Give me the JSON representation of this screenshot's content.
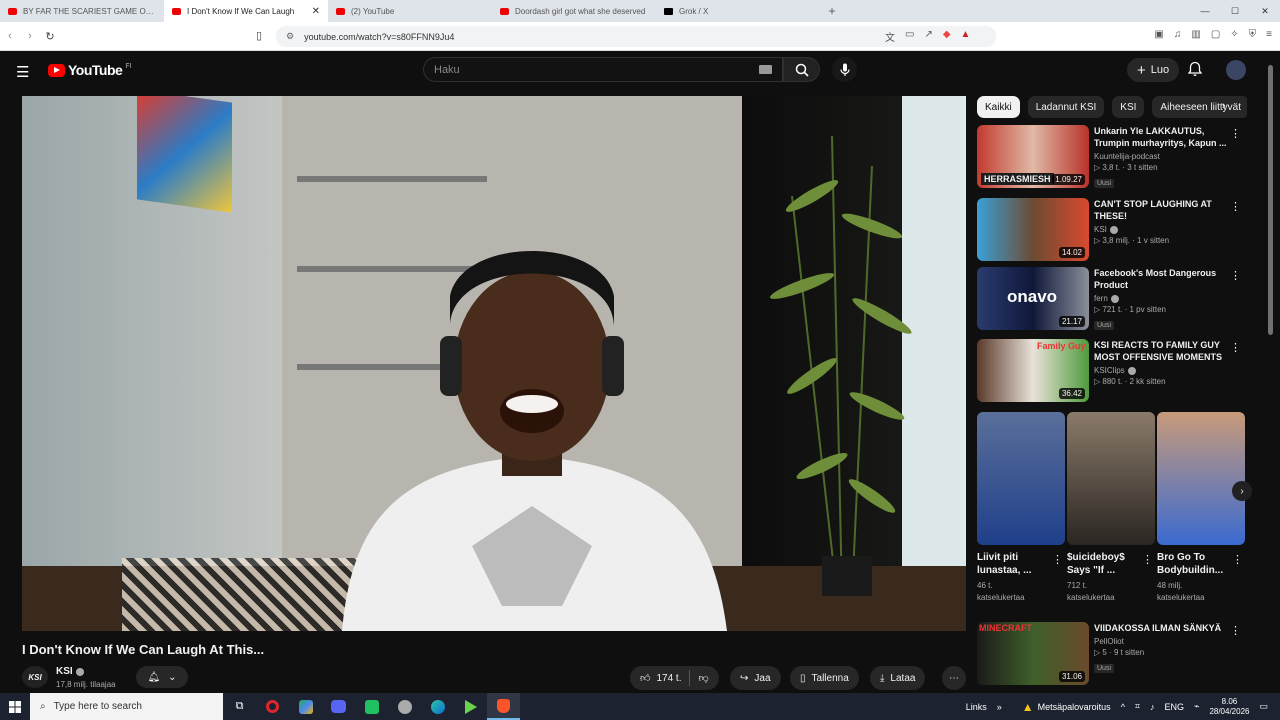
{
  "browser": {
    "tabs": [
      {
        "title": "BY FAR THE SCARIEST GAME OF THE",
        "icon": "youtube-icon",
        "active": false
      },
      {
        "title": "I Don't Know If We Can Laugh",
        "icon": "youtube-icon",
        "active": true
      },
      {
        "title": "(2) YouTube",
        "icon": "youtube-icon",
        "active": false
      },
      {
        "title": "Doordash girl got what she deserved",
        "icon": "youtube-icon",
        "active": false
      },
      {
        "title": "Grok / X",
        "icon": "x-icon",
        "active": false
      }
    ],
    "url": "youtube.com/watch?v=s80FFNN9Ju4"
  },
  "youtube": {
    "logo_text": "YouTube",
    "country": "FI",
    "search_placeholder": "Haku",
    "create_label": "Luo"
  },
  "video": {
    "title": "I Don't Know If We Can Laugh At This...",
    "channel": "KSI",
    "channel_avatar_text": "KSI",
    "subscribers": "17,8 milj. tilaajaa",
    "likes": "174 t.",
    "share_label": "Jaa",
    "save_label": "Tallenna",
    "download_label": "Lataa"
  },
  "chips": [
    "Kaikki",
    "Ladannut KSI",
    "KSI",
    "Aiheeseen liittyvät"
  ],
  "recommendations": [
    {
      "title": "Unkarin Yle LAKKAUTUS, Trumpin murhayritys, Kapun ...",
      "channel": "Kuuntelija-podcast",
      "views": "3,8 t.",
      "age": "3 t sitten",
      "badge": "Uusi",
      "duration": "1.09.27",
      "verified": false,
      "thumb_label": "HERRASMIESH"
    },
    {
      "title": "CAN'T STOP LAUGHING AT THESE!",
      "channel": "KSI",
      "views": "3,8 milj.",
      "age": "1 v sitten",
      "badge": "",
      "duration": "14.02",
      "verified": true,
      "thumb_label": ""
    },
    {
      "title": "Facebook's Most Dangerous Product",
      "channel": "fern",
      "views": "721 t.",
      "age": "1 pv sitten",
      "badge": "Uusi",
      "duration": "21.17",
      "verified": true,
      "thumb_label": "onavo"
    },
    {
      "title": "KSI REACTS TO FAMILY GUY MOST OFFENSIVE MOMENTS",
      "channel": "KSIClips",
      "views": "880 t.",
      "age": "2 kk sitten",
      "badge": "",
      "duration": "36.42",
      "verified": true,
      "thumb_label": "Family Guy"
    },
    {
      "title": "VIIDAKOSSA ILMAN SÄNKYÄ",
      "channel": "PellOliot",
      "views": "5",
      "age": "9 t sitten",
      "badge": "Uusi",
      "duration": "31.06",
      "verified": false,
      "thumb_label": "MINECRAFT"
    }
  ],
  "shorts": [
    {
      "title": "Liivit piti lunastaa, ...",
      "views": "46 t.",
      "views_label": "katselukertaa"
    },
    {
      "title": "$uicideboy$ Says \"If ...",
      "views": "712 t.",
      "views_label": "katselukertaa"
    },
    {
      "title": "Bro Go To Bodybuildin...",
      "views": "48 milj.",
      "views_label": "katselukertaa"
    }
  ],
  "taskbar": {
    "search_placeholder": "Type here to search",
    "links_label": "Links",
    "weather_alert": "Metsäpalovaroitus",
    "lang": "ENG",
    "time": "8.06",
    "date": "28/04/2026"
  },
  "colors": {
    "youtube_red": "#ff0000",
    "bg": "#0f0f0f",
    "chip_selected": "#f1f1f1"
  }
}
